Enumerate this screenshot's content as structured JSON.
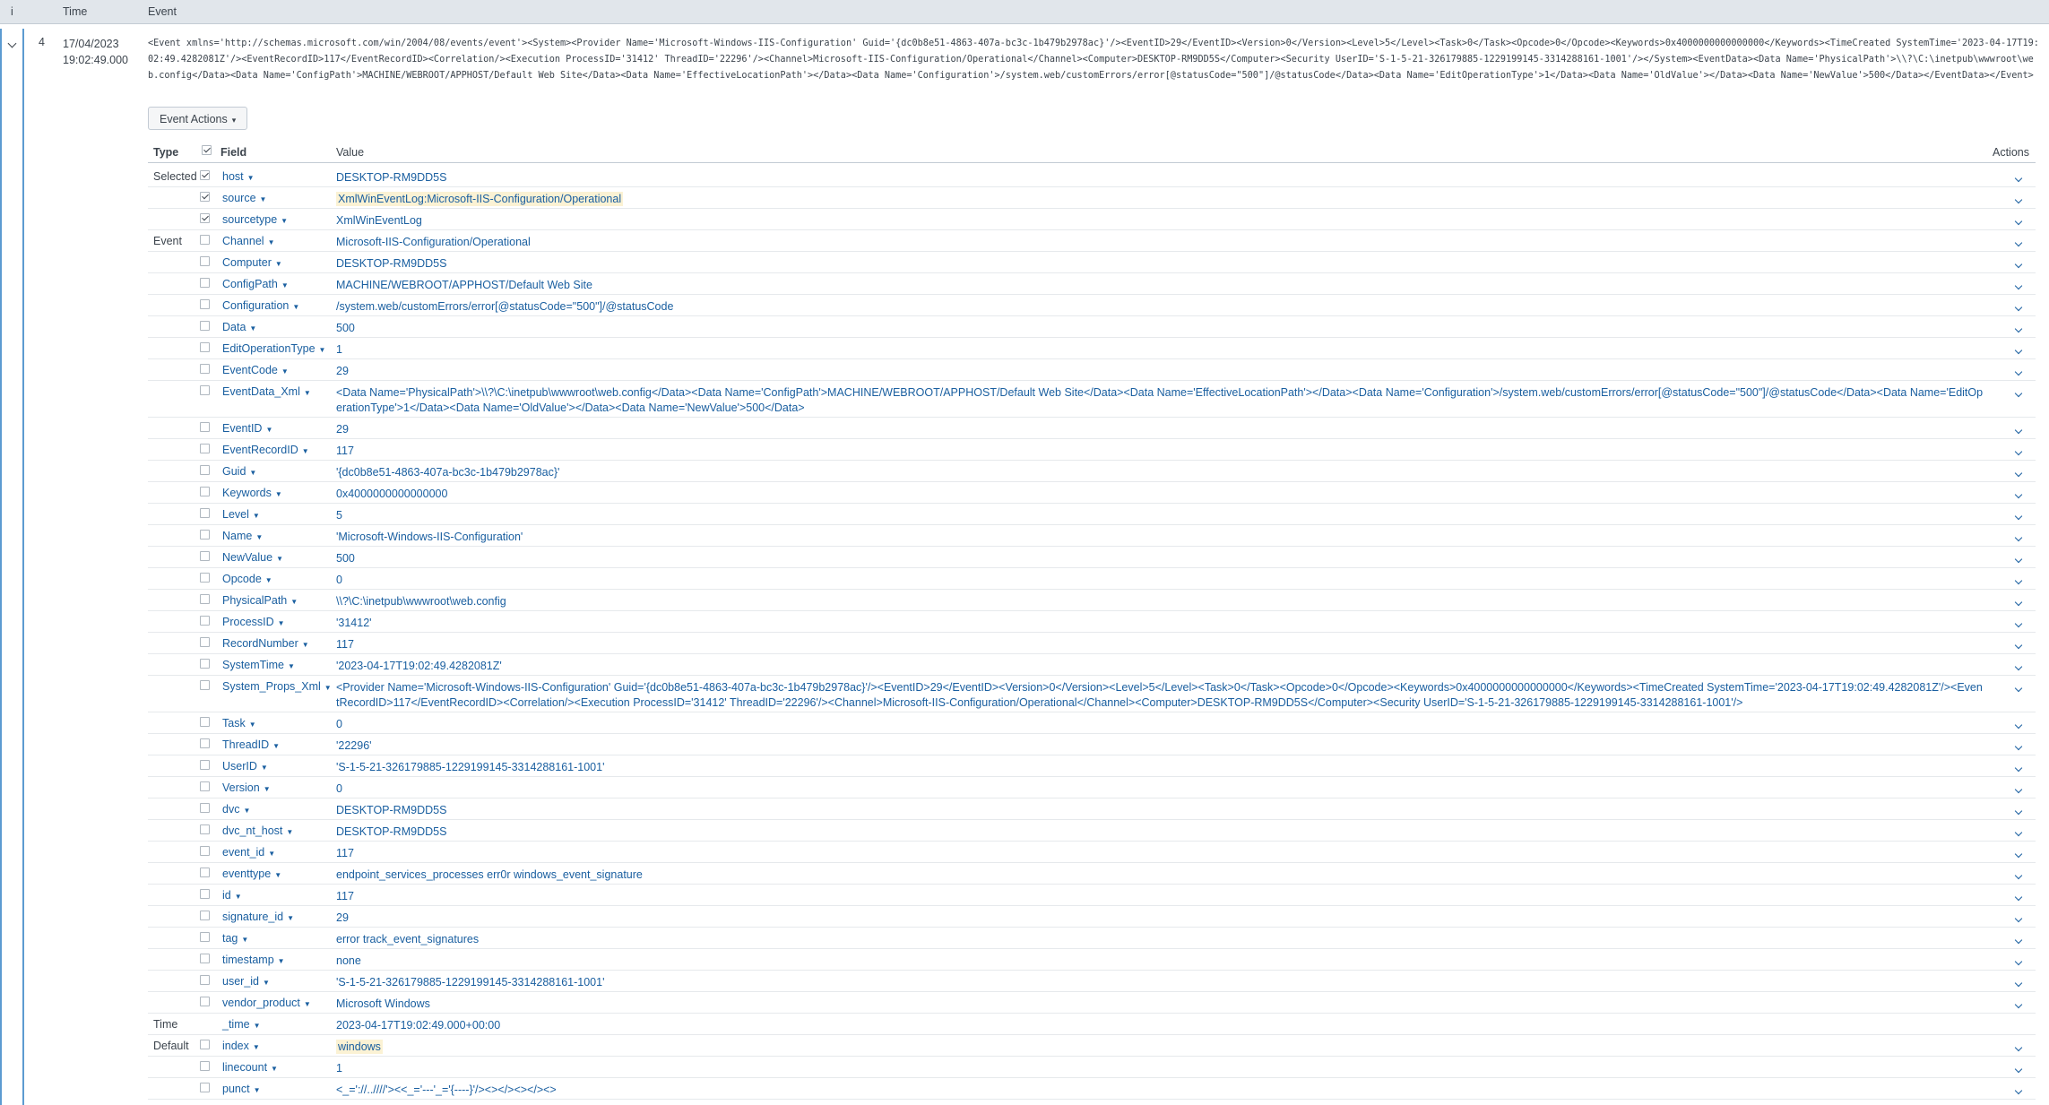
{
  "header": {
    "col_info": "i",
    "col_time": "Time",
    "col_event": "Event"
  },
  "event": {
    "row_number": "4",
    "date": "17/04/2023",
    "time": "19:02:49.000",
    "raw": "<Event xmlns='http://schemas.microsoft.com/win/2004/08/events/event'><System><Provider Name='Microsoft-Windows-IIS-Configuration' Guid='{dc0b8e51-4863-407a-bc3c-1b479b2978ac}'/><EventID>29</EventID><Version>0</Version><Level>5</Level><Task>0</Task><Opcode>0</Opcode><Keywords>0x4000000000000000</Keywords><TimeCreated SystemTime='2023-04-17T19:02:49.4282081Z'/><EventRecordID>117</EventRecordID><Correlation/><Execution ProcessID='31412' ThreadID='22296'/><Channel>Microsoft-IIS-Configuration/Operational</Channel><Computer>DESKTOP-RM9DD5S</Computer><Security UserID='S-1-5-21-326179885-1229199145-3314288161-1001'/></System><EventData><Data Name='PhysicalPath'>\\\\?\\C:\\inetpub\\wwwroot\\web.config</Data><Data Name='ConfigPath'>MACHINE/WEBROOT/APPHOST/Default Web Site</Data><Data Name='EffectiveLocationPath'></Data><Data Name='Configuration'>/system.web/customErrors/error[@statusCode=\"500\"]/@statusCode</Data><Data Name='EditOperationType'>1</Data><Data Name='OldValue'></Data><Data Name='NewValue'>500</Data></EventData></Event>",
    "actions_label": "Event Actions"
  },
  "table_headers": {
    "type": "Type",
    "field": "Field",
    "value": "Value",
    "actions": "Actions"
  },
  "fields": [
    {
      "group": "Selected",
      "checked": true,
      "name": "host",
      "value": "DESKTOP-RM9DD5S"
    },
    {
      "group": "",
      "checked": true,
      "name": "source",
      "value": "XmlWinEventLog:Microsoft-IIS-Configuration/Operational",
      "highlight": true
    },
    {
      "group": "",
      "checked": true,
      "name": "sourcetype",
      "value": "XmlWinEventLog"
    },
    {
      "group": "Event",
      "checked": false,
      "name": "Channel",
      "value": "Microsoft-IIS-Configuration/Operational"
    },
    {
      "group": "",
      "checked": false,
      "name": "Computer",
      "value": "DESKTOP-RM9DD5S"
    },
    {
      "group": "",
      "checked": false,
      "name": "ConfigPath",
      "value": "MACHINE/WEBROOT/APPHOST/Default Web Site"
    },
    {
      "group": "",
      "checked": false,
      "name": "Configuration",
      "value": "/system.web/customErrors/error[@statusCode=\"500\"]/@statusCode"
    },
    {
      "group": "",
      "checked": false,
      "name": "Data",
      "value": "500"
    },
    {
      "group": "",
      "checked": false,
      "name": "EditOperationType",
      "value": "1"
    },
    {
      "group": "",
      "checked": false,
      "name": "EventCode",
      "value": "29"
    },
    {
      "group": "",
      "checked": false,
      "name": "EventData_Xml",
      "value": "<Data Name='PhysicalPath'>\\\\?\\C:\\inetpub\\wwwroot\\web.config</Data><Data Name='ConfigPath'>MACHINE/WEBROOT/APPHOST/Default Web Site</Data><Data Name='EffectiveLocationPath'></Data><Data Name='Configuration'>/system.web/customErrors/error[@statusCode=\"500\"]/@statusCode</Data><Data Name='EditOperationType'>1</Data><Data Name='OldValue'></Data><Data Name='NewValue'>500</Data>",
      "tall": true
    },
    {
      "group": "",
      "checked": false,
      "name": "EventID",
      "value": "29"
    },
    {
      "group": "",
      "checked": false,
      "name": "EventRecordID",
      "value": "117"
    },
    {
      "group": "",
      "checked": false,
      "name": "Guid",
      "value": "'{dc0b8e51-4863-407a-bc3c-1b479b2978ac}'"
    },
    {
      "group": "",
      "checked": false,
      "name": "Keywords",
      "value": "0x4000000000000000"
    },
    {
      "group": "",
      "checked": false,
      "name": "Level",
      "value": "5"
    },
    {
      "group": "",
      "checked": false,
      "name": "Name",
      "value": "'Microsoft-Windows-IIS-Configuration'"
    },
    {
      "group": "",
      "checked": false,
      "name": "NewValue",
      "value": "500"
    },
    {
      "group": "",
      "checked": false,
      "name": "Opcode",
      "value": "0"
    },
    {
      "group": "",
      "checked": false,
      "name": "PhysicalPath",
      "value": "\\\\?\\C:\\inetpub\\wwwroot\\web.config"
    },
    {
      "group": "",
      "checked": false,
      "name": "ProcessID",
      "value": "'31412'"
    },
    {
      "group": "",
      "checked": false,
      "name": "RecordNumber",
      "value": "117"
    },
    {
      "group": "",
      "checked": false,
      "name": "SystemTime",
      "value": "'2023-04-17T19:02:49.4282081Z'"
    },
    {
      "group": "",
      "checked": false,
      "name": "System_Props_Xml",
      "value": "<Provider Name='Microsoft-Windows-IIS-Configuration' Guid='{dc0b8e51-4863-407a-bc3c-1b479b2978ac}'/><EventID>29</EventID><Version>0</Version><Level>5</Level><Task>0</Task><Opcode>0</Opcode><Keywords>0x4000000000000000</Keywords><TimeCreated SystemTime='2023-04-17T19:02:49.4282081Z'/><EventRecordID>117</EventRecordID><Correlation/><Execution ProcessID='31412' ThreadID='22296'/><Channel>Microsoft-IIS-Configuration/Operational</Channel><Computer>DESKTOP-RM9DD5S</Computer><Security UserID='S-1-5-21-326179885-1229199145-3314288161-1001'/>",
      "tall": true
    },
    {
      "group": "",
      "checked": false,
      "name": "Task",
      "value": "0"
    },
    {
      "group": "",
      "checked": false,
      "name": "ThreadID",
      "value": "'22296'"
    },
    {
      "group": "",
      "checked": false,
      "name": "UserID",
      "value": "'S-1-5-21-326179885-1229199145-3314288161-1001'"
    },
    {
      "group": "",
      "checked": false,
      "name": "Version",
      "value": "0"
    },
    {
      "group": "",
      "checked": false,
      "name": "dvc",
      "value": "DESKTOP-RM9DD5S"
    },
    {
      "group": "",
      "checked": false,
      "name": "dvc_nt_host",
      "value": "DESKTOP-RM9DD5S"
    },
    {
      "group": "",
      "checked": false,
      "name": "event_id",
      "value": "117"
    },
    {
      "group": "",
      "checked": false,
      "name": "eventtype",
      "value": "endpoint_services_processes err0r windows_event_signature"
    },
    {
      "group": "",
      "checked": false,
      "name": "id",
      "value": "117"
    },
    {
      "group": "",
      "checked": false,
      "name": "signature_id",
      "value": "29"
    },
    {
      "group": "",
      "checked": false,
      "name": "tag",
      "value": "error track_event_signatures"
    },
    {
      "group": "",
      "checked": false,
      "name": "timestamp",
      "value": "none"
    },
    {
      "group": "",
      "checked": false,
      "name": "user_id",
      "value": "'S-1-5-21-326179885-1229199145-3314288161-1001'"
    },
    {
      "group": "",
      "checked": false,
      "name": "vendor_product",
      "value": "Microsoft Windows"
    },
    {
      "group": "Time",
      "checked": null,
      "name": "_time",
      "value": "2023-04-17T19:02:49.000+00:00",
      "no_action": true
    },
    {
      "group": "Default",
      "checked": false,
      "name": "index",
      "value": "windows",
      "highlight": true
    },
    {
      "group": "",
      "checked": false,
      "name": "linecount",
      "value": "1"
    },
    {
      "group": "",
      "checked": false,
      "name": "punct",
      "value": "<_='://..////'><<_='---'_='{----}'/><></><></><>"
    }
  ]
}
